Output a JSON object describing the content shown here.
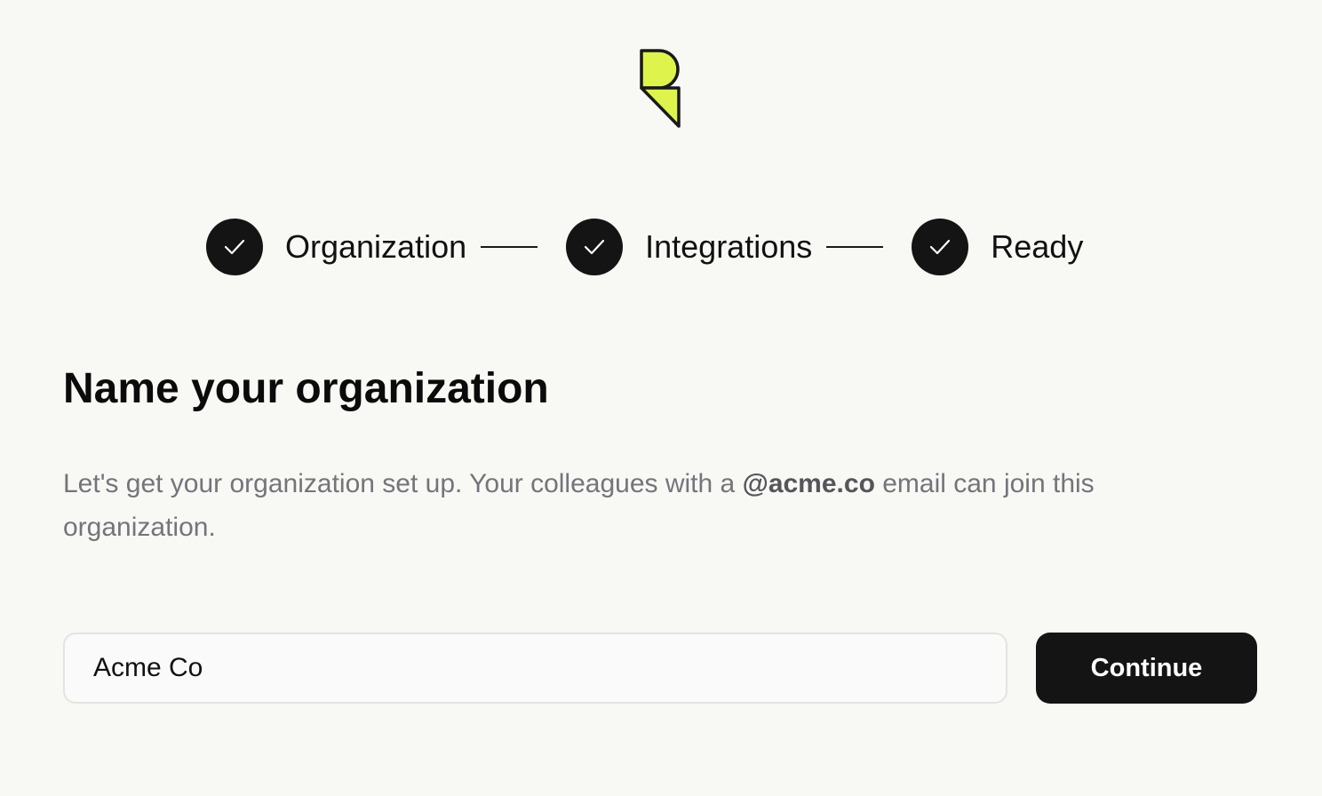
{
  "brand": {
    "logo_icon": "brand-logo-icon",
    "logo_fill": "#dff34d",
    "logo_stroke": "#1a1a1a"
  },
  "stepper": {
    "steps": [
      {
        "label": "Organization",
        "status": "completed",
        "icon": "check-icon"
      },
      {
        "label": "Integrations",
        "status": "completed",
        "icon": "check-icon"
      },
      {
        "label": "Ready",
        "status": "completed",
        "icon": "check-icon"
      }
    ]
  },
  "main": {
    "title": "Name your organization",
    "description_prefix": "Let's get your organization set up. Your colleagues with a ",
    "description_domain": "@acme.co",
    "description_suffix": " email can join this organization."
  },
  "form": {
    "org_name_value": "Acme Co",
    "continue_label": "Continue"
  },
  "colors": {
    "background": "#f8f8f5",
    "primary": "#141414",
    "text_muted": "#74747a"
  }
}
